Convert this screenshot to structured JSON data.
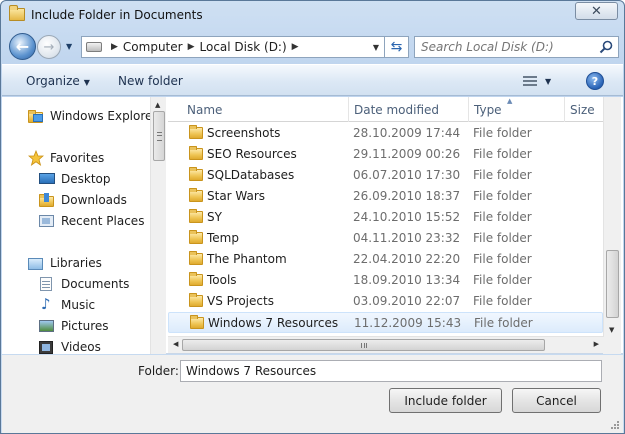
{
  "window": {
    "title": "Include Folder in Documents",
    "close_glyph": "✕"
  },
  "address": {
    "crumbs": [
      "Computer",
      "Local Disk (D:)"
    ],
    "search_placeholder": "Search Local Disk (D:)"
  },
  "toolbar": {
    "organize_label": "Organize",
    "new_folder_label": "New folder"
  },
  "nav": {
    "items": [
      {
        "label": "Windows Explorer",
        "icon": "windows-explorer-icon",
        "level": 0
      },
      {
        "label": "Favorites",
        "icon": "star-icon",
        "level": 0
      },
      {
        "label": "Desktop",
        "icon": "desktop-icon",
        "level": 1
      },
      {
        "label": "Downloads",
        "icon": "downloads-icon",
        "level": 1
      },
      {
        "label": "Recent Places",
        "icon": "recent-places-icon",
        "level": 1
      },
      {
        "label": "Libraries",
        "icon": "libraries-icon",
        "level": 0
      },
      {
        "label": "Documents",
        "icon": "documents-icon",
        "level": 1
      },
      {
        "label": "Music",
        "icon": "music-icon",
        "level": 1
      },
      {
        "label": "Pictures",
        "icon": "pictures-icon",
        "level": 1
      },
      {
        "label": "Videos",
        "icon": "videos-icon",
        "level": 1
      }
    ]
  },
  "files": {
    "columns": [
      "Name",
      "Date modified",
      "Type",
      "Size"
    ],
    "rows": [
      {
        "name": "Screenshots",
        "date": "28.10.2009 17:44",
        "type": "File folder"
      },
      {
        "name": "SEO Resources",
        "date": "29.11.2009 00:26",
        "type": "File folder"
      },
      {
        "name": "SQLDatabases",
        "date": "06.07.2010 17:30",
        "type": "File folder"
      },
      {
        "name": "Star Wars",
        "date": "26.09.2010 18:37",
        "type": "File folder"
      },
      {
        "name": "SY",
        "date": "24.10.2010 15:52",
        "type": "File folder"
      },
      {
        "name": "Temp",
        "date": "04.11.2010 23:32",
        "type": "File folder"
      },
      {
        "name": "The Phantom",
        "date": "22.04.2010 22:20",
        "type": "File folder"
      },
      {
        "name": "Tools",
        "date": "18.09.2010 13:34",
        "type": "File folder"
      },
      {
        "name": "VS Projects",
        "date": "03.09.2010 22:07",
        "type": "File folder"
      },
      {
        "name": "Windows 7 Resources",
        "date": "11.12.2009 15:43",
        "type": "File folder"
      }
    ],
    "selected_index": 9
  },
  "footer": {
    "folder_label": "Folder:",
    "folder_value": "Windows 7 Resources",
    "include_button": "Include folder",
    "cancel_button": "Cancel"
  },
  "colors": {
    "selection_bg": "#dcebfc",
    "selection_border": "#cde3fb",
    "header_text": "#4c607a",
    "folder_yellow": "#eec453"
  }
}
